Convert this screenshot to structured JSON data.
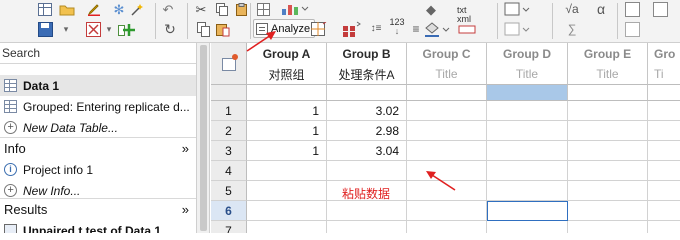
{
  "toolbar": {
    "analyze_label": "Analyze",
    "sheet_icon_label": "txt xml",
    "sqrt_label": "√a",
    "alpha_label": "α",
    "number_label": "123",
    "icons": [
      "table-new-icon",
      "folder-open-icon",
      "save-icon",
      "pen-icon",
      "snowflake-icon",
      "wand-icon",
      "undo-icon",
      "redo-icon",
      "cut-icon",
      "copy-icon",
      "paste-icon",
      "delete-icon",
      "insert-row-icon",
      "grid-icon",
      "analyze-icon",
      "chart-icon",
      "sort-icon",
      "fill-icon",
      "color-icon",
      "text-xml-icon",
      "shape-icon",
      "sqrt-icon",
      "alpha-icon"
    ]
  },
  "navigator": {
    "search_placeholder": "Search",
    "data_tables": [
      {
        "label": "Data 1",
        "selected": true
      },
      {
        "label": "Grouped: Entering replicate d...",
        "selected": false
      },
      {
        "label": "New Data Table...",
        "selected": false
      }
    ],
    "info_section": "Info",
    "info_items": [
      {
        "label": "Project info 1"
      },
      {
        "label": "New Info..."
      }
    ],
    "results_section": "Results",
    "results_items": [
      {
        "label": "Unpaired t test of Data 1"
      }
    ]
  },
  "sheet": {
    "columns": [
      {
        "name": "Group A",
        "title": "对照组"
      },
      {
        "name": "Group B",
        "title": "处理条件A"
      },
      {
        "name": "Group C",
        "title": "Title"
      },
      {
        "name": "Group D",
        "title": "Title"
      },
      {
        "name": "Group E",
        "title": "Title"
      },
      {
        "name": "Gro",
        "title": "Ti"
      }
    ],
    "row_numbers": [
      "1",
      "2",
      "3",
      "4",
      "5",
      "6",
      "7"
    ],
    "active_row": "6",
    "rows": [
      [
        "1",
        "3.02",
        "",
        "",
        "",
        ""
      ],
      [
        "1",
        "2.98",
        "",
        "",
        "",
        ""
      ],
      [
        "1",
        "3.04",
        "",
        "",
        "",
        ""
      ],
      [
        "",
        "",
        "",
        "",
        "",
        ""
      ],
      [
        "",
        "",
        "",
        "",
        "",
        ""
      ],
      [
        "",
        "",
        "",
        "",
        "",
        ""
      ],
      [
        "",
        "",
        "",
        "",
        "",
        ""
      ]
    ],
    "annotation": "粘贴数据"
  },
  "colors": {
    "annotation_red": "#e02020",
    "selection_blue": "#2f6fc0",
    "header_highlight": "#a9c8e8"
  }
}
